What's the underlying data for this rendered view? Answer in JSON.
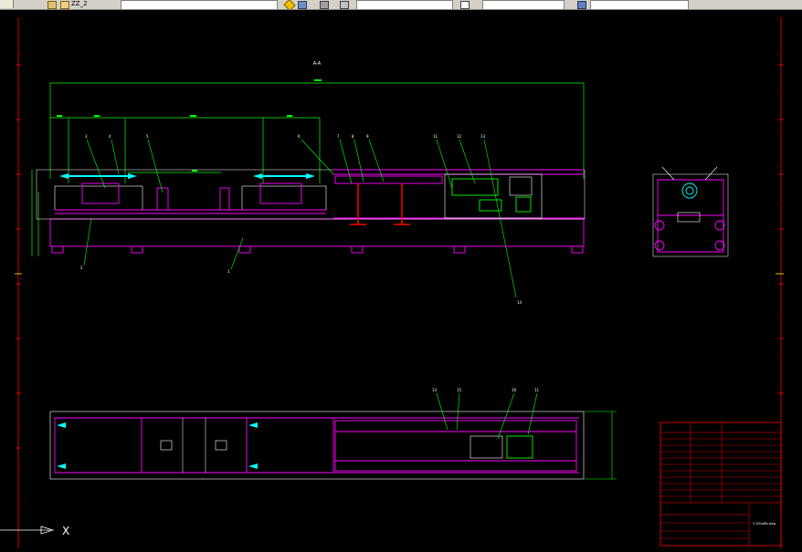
{
  "app": {
    "toolbar_file_label": "ZZ_2"
  },
  "drawing": {
    "view_label_top": "A-A",
    "callouts_front": [
      "3",
      "4",
      "5",
      "6",
      "7",
      "8",
      "9",
      "11",
      "12",
      "13",
      "2",
      "1",
      "14"
    ],
    "callouts_plan": [
      "13",
      "15",
      "16",
      "11"
    ],
    "title_block_name": "Y-1D1e8b.dwg",
    "axis_x": "X"
  },
  "colors": {
    "background": "#000000",
    "magenta": "#ff00ff",
    "green": "#00ff00",
    "cyan": "#00ffff",
    "red": "#ff0000",
    "white": "#ffffff",
    "yellow": "#ffff00"
  }
}
